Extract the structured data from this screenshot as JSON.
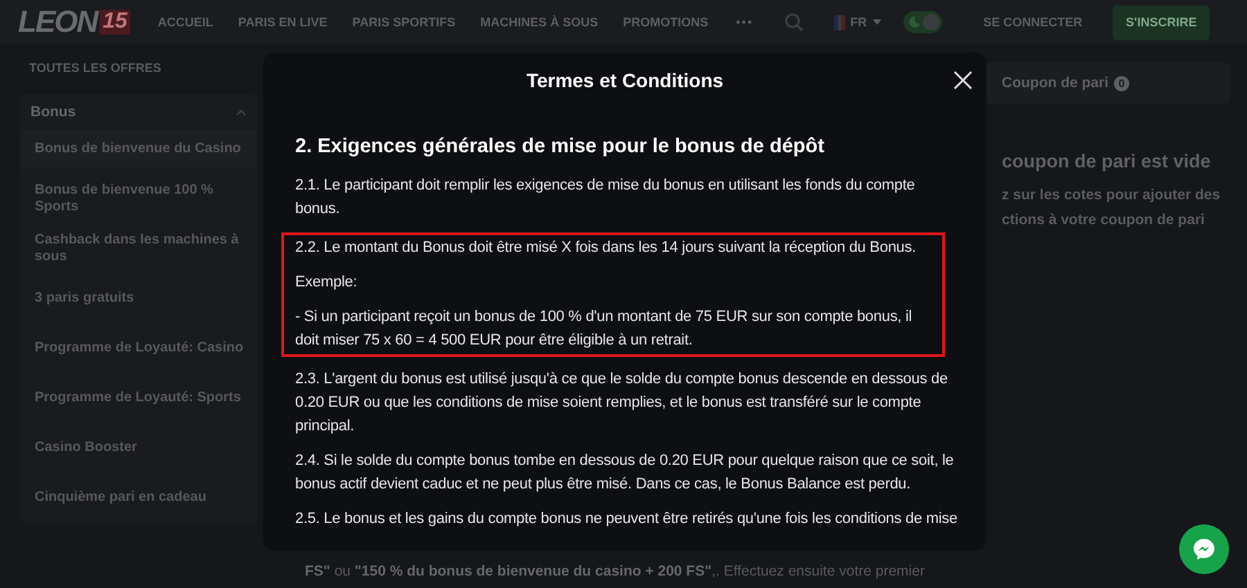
{
  "header": {
    "logo": "LEON",
    "logo_badge": "15",
    "nav": [
      "ACCUEIL",
      "PARIS EN LIVE",
      "PARIS SPORTIFS",
      "MACHINES À SOUS",
      "PROMOTIONS"
    ],
    "more": "•••",
    "language": "FR",
    "dark_mode": true,
    "login": "SE CONNECTER",
    "signup": "S'INSCRIRE"
  },
  "sidebar": {
    "title": "TOUTES LES OFFRES",
    "group": {
      "label": "Bonus",
      "expanded": true,
      "items": [
        {
          "label": "Bonus de bienvenue du Casino",
          "selected": true
        },
        {
          "label": "Bonus de bienvenue 100 % Sports",
          "selected": false
        },
        {
          "label": "Cashback dans les machines à sous",
          "selected": false
        },
        {
          "label": "3 paris gratuits",
          "selected": false
        },
        {
          "label": "Programme de Loyauté: Casino",
          "selected": false
        },
        {
          "label": "Programme de Loyauté: Sports",
          "selected": false
        },
        {
          "label": "Casino Booster",
          "selected": false
        },
        {
          "label": "Cinquième pari en cadeau",
          "selected": false
        }
      ]
    }
  },
  "coupon": {
    "title": "Coupon de pari",
    "count": "0",
    "empty_title": "coupon de pari est vide",
    "empty_lines": [
      "z sur les cotes pour ajouter des",
      "ctions à votre coupon de pari"
    ]
  },
  "background_text": "**FS\"** ou **\"150 % du bonus de bienvenue du casino + 200 FS\"**,. Effectuez ensuite votre premier",
  "modal": {
    "title": "Termes et Conditions",
    "heading": "2. Exigences générales de mise pour le bonus de dépôt",
    "paragraphs": [
      {
        "text": "2.1. Le participant doit remplir les exigences de mise du bonus en utilisant les fonds du compte bonus.",
        "highlighted": false
      },
      {
        "text": "2.2. Le montant du Bonus doit être misé X fois dans les 14 jours suivant la réception du Bonus.",
        "highlighted": true
      },
      {
        "text": "Exemple:",
        "highlighted": true
      },
      {
        "text": "- Si un participant reçoit un bonus de 100 % d'un montant de 75 EUR sur son compte bonus, il doit miser 75 x 60 = 4 500 EUR pour être éligible à un retrait.",
        "highlighted": true
      },
      {
        "text": "2.3. L'argent du bonus est utilisé jusqu'à ce que le solde du compte bonus descende en dessous de 0.20 EUR ou que les conditions de mise soient remplies, et le bonus est transféré sur le compte principal.",
        "highlighted": false
      },
      {
        "text": "2.4. Si le solde du compte bonus tombe en dessous de 0.20 EUR pour quelque raison que ce soit, le bonus actif devient caduc et ne peut plus être misé. Dans ce cas, le Bonus Balance est perdu.",
        "highlighted": false
      },
      {
        "text": "2.5. Le bonus et les gains du compte bonus ne peuvent être retirés qu'une fois les conditions de mise",
        "highlighted": false
      }
    ]
  }
}
